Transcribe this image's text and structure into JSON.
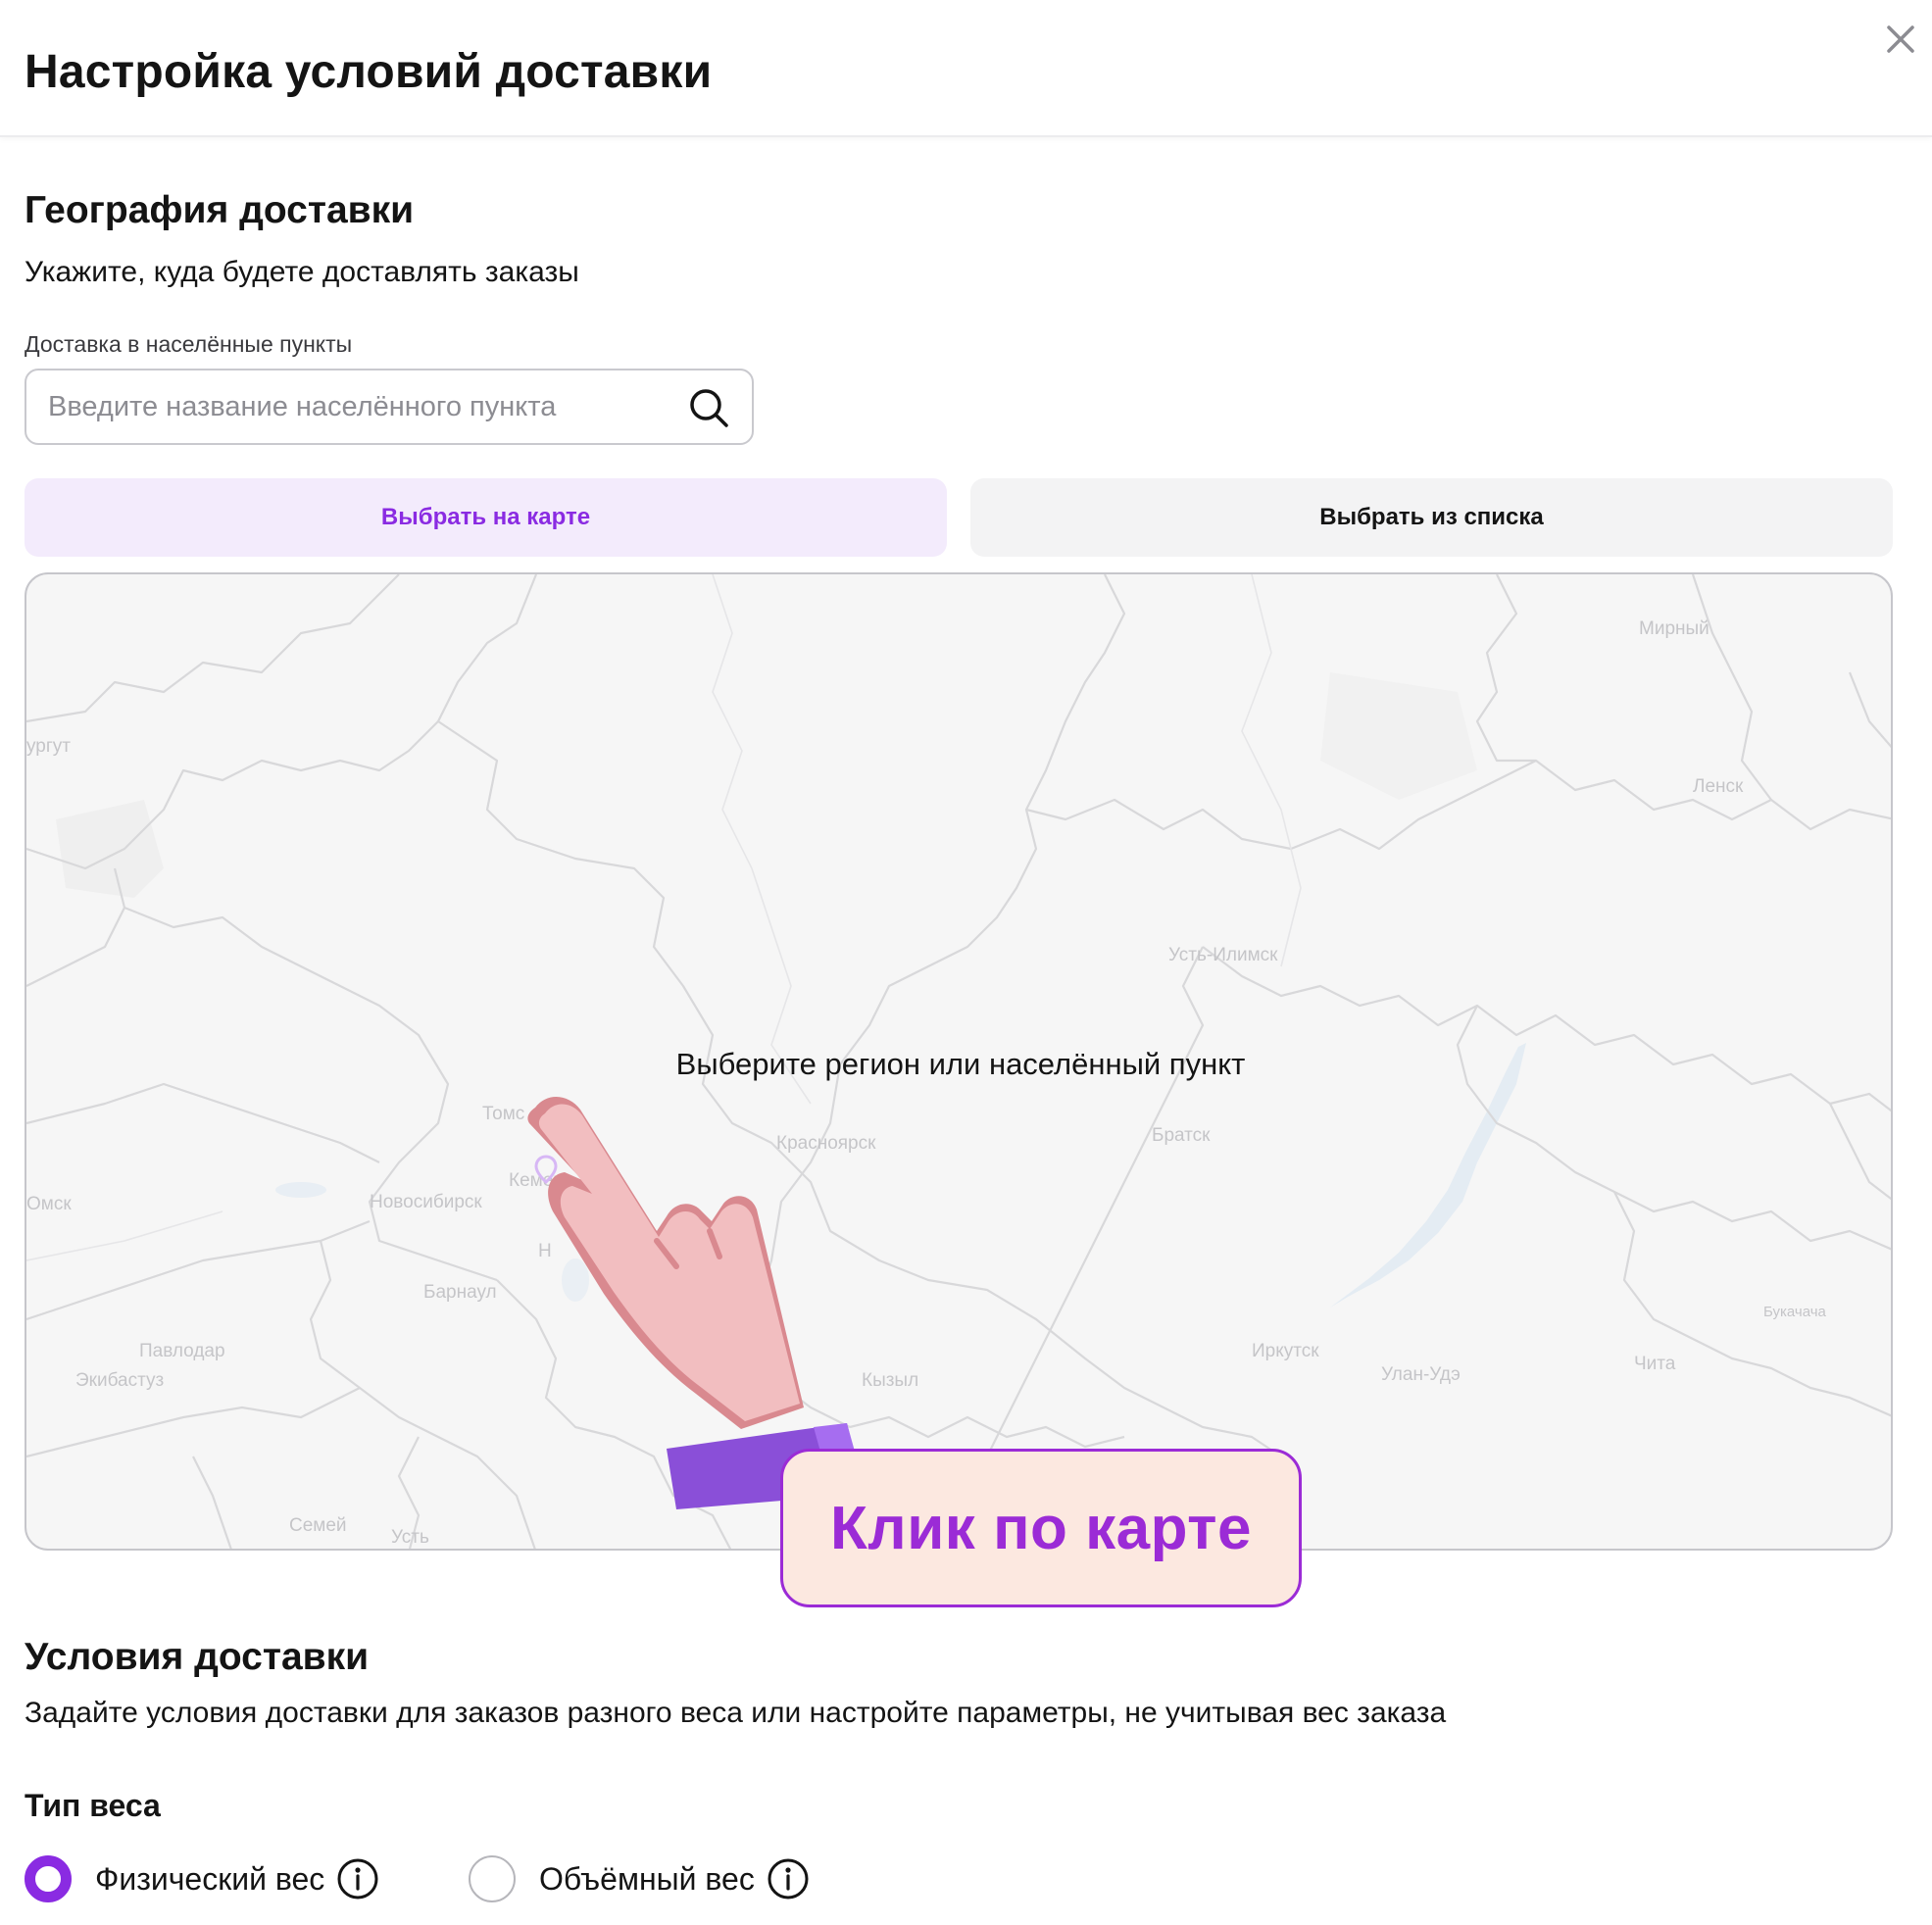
{
  "header": {
    "title": "Настройка условий доставки",
    "close_icon": "close-icon"
  },
  "geography": {
    "title": "География доставки",
    "subtitle": "Укажите, куда будете доставлять заказы",
    "field_label": "Доставка в населённые пункты",
    "search_placeholder": "Введите название населённого пункта",
    "search_value": "",
    "search_icon": "search-icon",
    "tabs": [
      {
        "label": "Выбрать на карте",
        "active": true
      },
      {
        "label": "Выбрать из списка",
        "active": false
      }
    ]
  },
  "map": {
    "hint": "Выберите регион или населённый пункт",
    "cities": [
      "Мирный",
      "ургут",
      "Ленск",
      "Усть-Илимск",
      "Томс",
      "Красноярск",
      "Братск",
      "Кемер",
      "Новосибирск",
      "Омск",
      "Н",
      "Барнаул",
      "Букачача",
      "Павлодар",
      "Иркутск",
      "Улан-Удэ",
      "Чита",
      "Экибастуз",
      "Кызыл",
      "Семей",
      "Усть"
    ],
    "pin_icon": "map-pin-icon",
    "hand_icon": "pointing-hand-icon"
  },
  "callout": {
    "text": "Клик по карте"
  },
  "delivery_conditions": {
    "title": "Условия доставки",
    "subtitle": "Задайте условия доставки для заказов разного веса или настройте параметры, не учитывая вес заказа",
    "weight_type_label": "Тип веса",
    "options": [
      {
        "label": "Физический вес",
        "selected": true,
        "info_icon": "info-icon"
      },
      {
        "label": "Объёмный вес",
        "selected": false,
        "info_icon": "info-icon"
      }
    ]
  },
  "colors": {
    "accent": "#8a2be2",
    "tab_active_bg": "#f3ebfc",
    "tab_inactive_bg": "#f3f3f4",
    "callout_bg": "#fce8e0",
    "callout_text": "#9b2bd6"
  }
}
